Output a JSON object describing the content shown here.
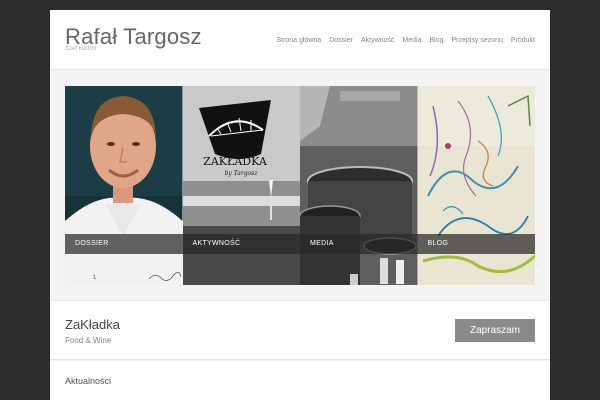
{
  "header": {
    "title": "Rafał Targosz",
    "subtitle": "Szef kuchni",
    "nav": [
      "Strona główna",
      "Dossier",
      "Aktywność",
      "Media",
      "Blog",
      "Przepisy sezonu",
      "Produkt"
    ]
  },
  "panels": [
    {
      "label": "DOSSIER",
      "signature": "Rafał Targosz"
    },
    {
      "label": "AKTYWNOŚĆ",
      "logo_text": "ZAKŁADKA",
      "logo_sub": "by Targosz"
    },
    {
      "label": "MEDIA"
    },
    {
      "label": "BLOG"
    }
  ],
  "slider": {
    "current": "1"
  },
  "cta": {
    "title": "ZaKładka",
    "subtitle": "Food & Wine",
    "button": "Zapraszam"
  },
  "news": {
    "title": "Aktualności"
  }
}
